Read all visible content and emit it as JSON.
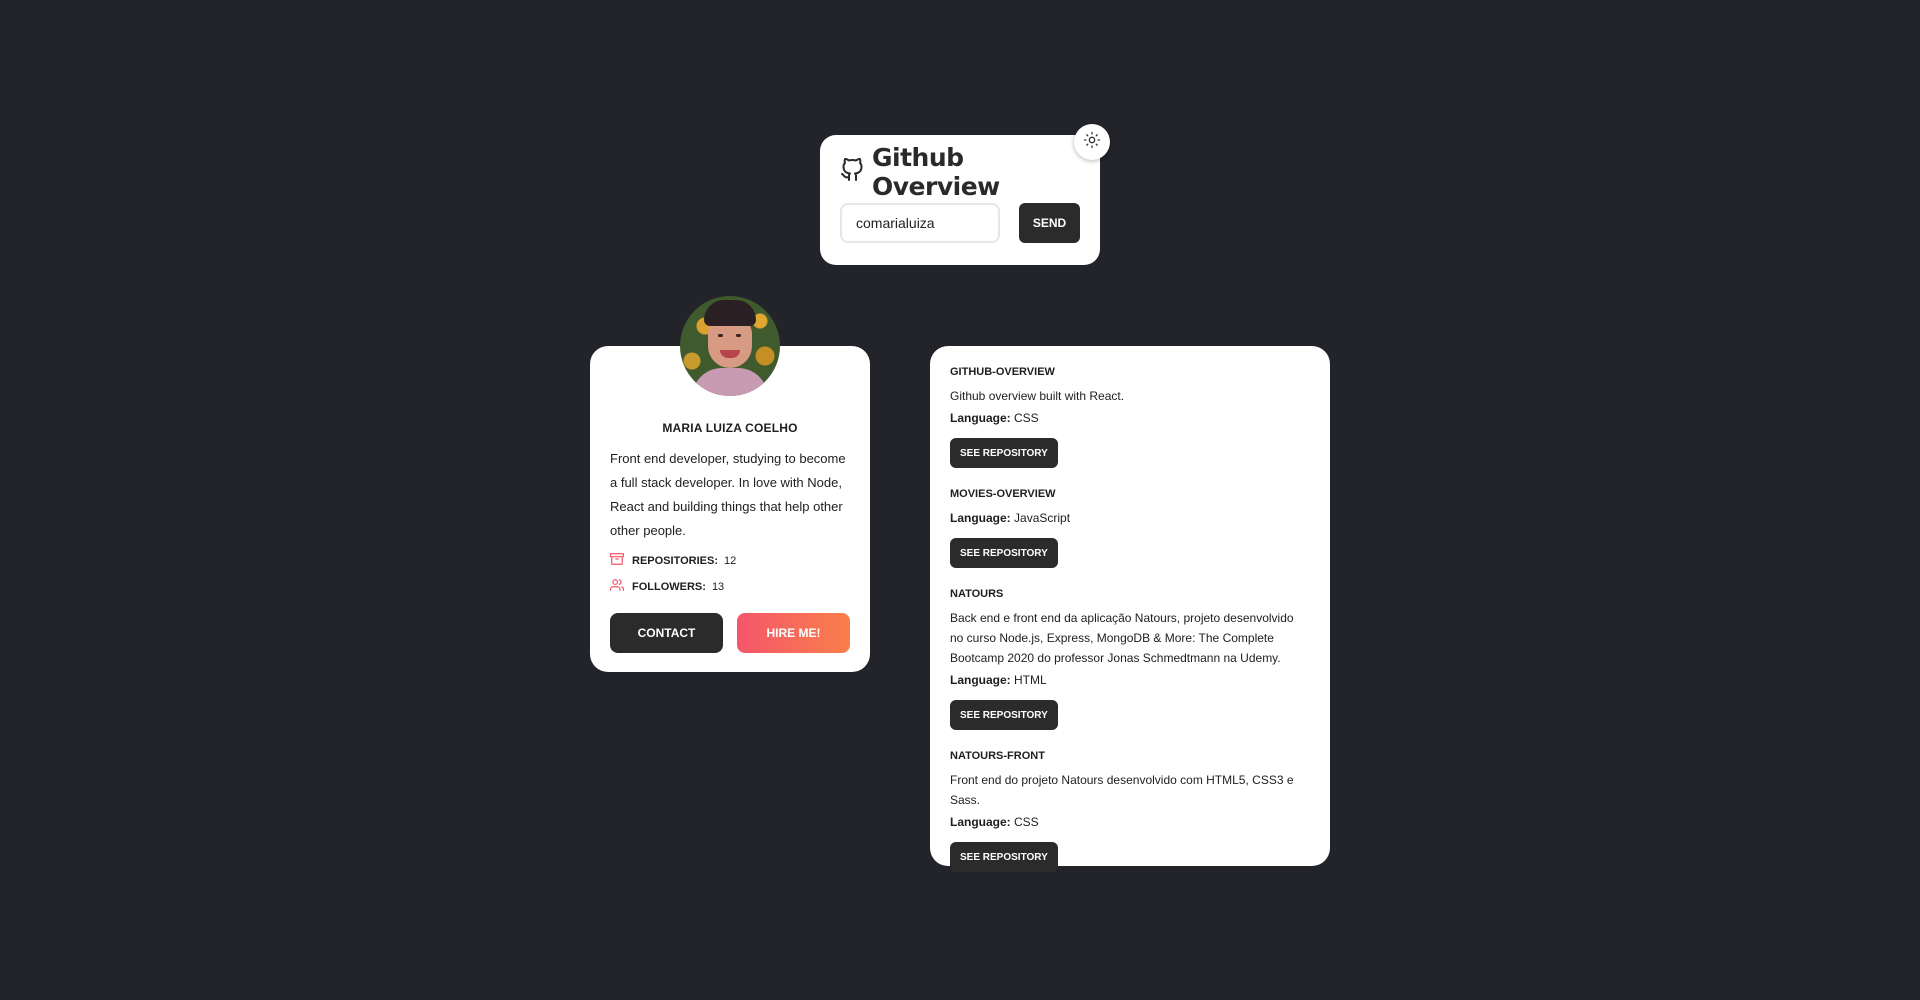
{
  "header": {
    "title": "Github Overview",
    "brand_icon": "github-icon",
    "theme_toggle_icon": "sun-icon"
  },
  "search": {
    "value": "comarialuiza",
    "button_label": "SEND"
  },
  "profile": {
    "name": "MARIA LUIZA COELHO",
    "bio": "Front end developer, studying to become a full stack developer. In love with Node, React and building things that help other other people.",
    "stats": [
      {
        "icon": "archive-icon",
        "label": "REPOSITORIES:",
        "value": "12"
      },
      {
        "icon": "users-icon",
        "label": "FOLLOWERS:",
        "value": "13"
      }
    ],
    "contact_label": "CONTACT",
    "hire_label": "HIRE ME!",
    "accent_colors": [
      "#f5566a",
      "#f97f4a"
    ]
  },
  "repositories": {
    "language_key": "Language:",
    "button_label": "SEE REPOSITORY",
    "items": [
      {
        "name": "GITHUB-OVERVIEW",
        "description": "Github overview built with React.",
        "language": "CSS"
      },
      {
        "name": "MOVIES-OVERVIEW",
        "description": "",
        "language": "JavaScript"
      },
      {
        "name": "NATOURS",
        "description": "Back end e front end da aplicação Natours, projeto desenvolvido no curso Node.js, Express, MongoDB & More: The Complete Bootcamp 2020 do professor Jonas Schmedtmann na Udemy.",
        "language": "HTML"
      },
      {
        "name": "NATOURS-FRONT",
        "description": "Front end do projeto Natours desenvolvido com HTML5, CSS3 e Sass.",
        "language": "CSS"
      }
    ]
  },
  "colors": {
    "background": "#22242a",
    "card": "#ffffff",
    "dark_button": "#2b2b2b"
  }
}
